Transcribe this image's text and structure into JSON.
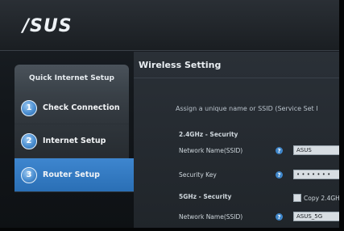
{
  "brand": {
    "logo_text": "/SUS"
  },
  "sidebar": {
    "title": "Quick Internet Setup",
    "steps": [
      {
        "num": "1",
        "label": "Check Connection"
      },
      {
        "num": "2",
        "label": "Internet Setup"
      },
      {
        "num": "3",
        "label": "Router Setup"
      }
    ]
  },
  "main": {
    "title": "Wireless Setting",
    "instruction": "Assign a unique name or SSID (Service Set I",
    "section_24": "2.4GHz - Security",
    "network_name_label": "Network Name(SSID)",
    "ssid_24_value": "ASUS",
    "security_key_label": "Security Key",
    "security_key_value": "• • • • • • •",
    "section_5": "5GHz - Security",
    "copy_label": "Copy 2.4GH",
    "network_name_label_5": "Network Name(SSID)",
    "ssid_5_value": "ASUS_5G",
    "help_glyph": "?"
  }
}
